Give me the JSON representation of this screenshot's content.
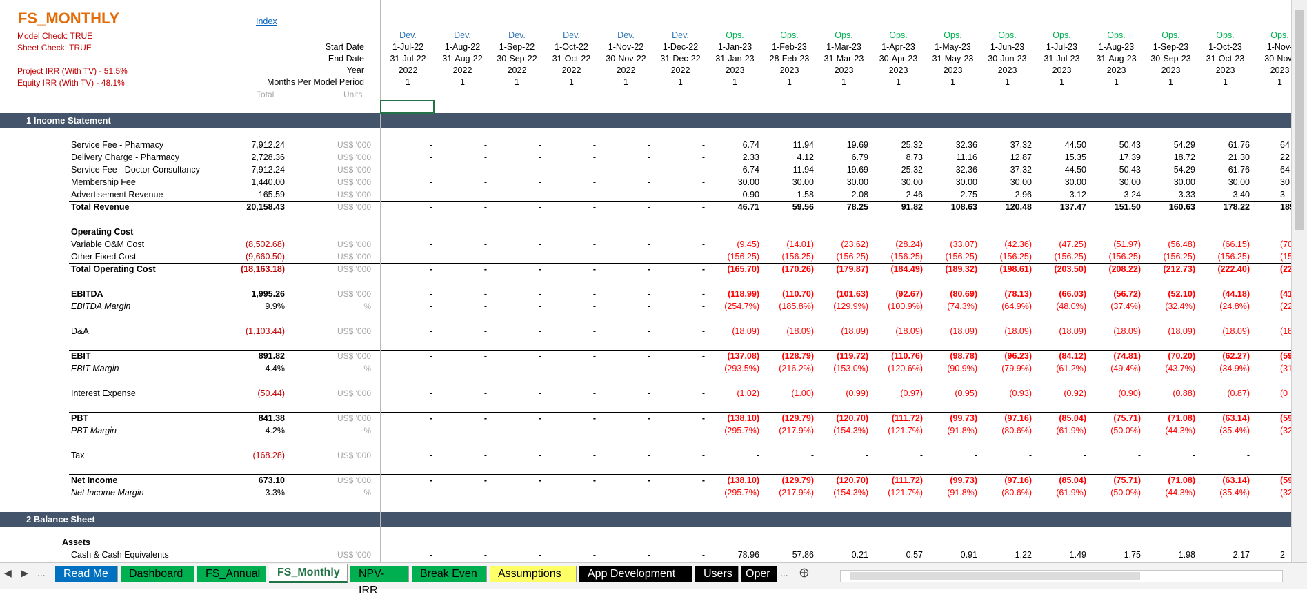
{
  "title": "FS_MONTHLY",
  "checks": {
    "model_check": "Model Check: TRUE",
    "sheet_check": "Sheet Check: TRUE",
    "project_irr": "Project IRR  (With TV) - 51.5%",
    "equity_irr": "Equity IRR  (With TV) - 48.1%"
  },
  "index_link": "Index",
  "header_labels": {
    "start_date": "Start Date",
    "end_date": "End Date",
    "year": "Year",
    "months": "Months Per Model Period",
    "total": "Total",
    "units": "Units"
  },
  "periods": [
    {
      "phase": "Dev.",
      "start": "1-Jul-22",
      "end": "31-Jul-22",
      "year": "2022",
      "months": "1"
    },
    {
      "phase": "Dev.",
      "start": "1-Aug-22",
      "end": "31-Aug-22",
      "year": "2022",
      "months": "1"
    },
    {
      "phase": "Dev.",
      "start": "1-Sep-22",
      "end": "30-Sep-22",
      "year": "2022",
      "months": "1"
    },
    {
      "phase": "Dev.",
      "start": "1-Oct-22",
      "end": "31-Oct-22",
      "year": "2022",
      "months": "1"
    },
    {
      "phase": "Dev.",
      "start": "1-Nov-22",
      "end": "30-Nov-22",
      "year": "2022",
      "months": "1"
    },
    {
      "phase": "Dev.",
      "start": "1-Dec-22",
      "end": "31-Dec-22",
      "year": "2022",
      "months": "1"
    },
    {
      "phase": "Ops.",
      "start": "1-Jan-23",
      "end": "31-Jan-23",
      "year": "2023",
      "months": "1"
    },
    {
      "phase": "Ops.",
      "start": "1-Feb-23",
      "end": "28-Feb-23",
      "year": "2023",
      "months": "1"
    },
    {
      "phase": "Ops.",
      "start": "1-Mar-23",
      "end": "31-Mar-23",
      "year": "2023",
      "months": "1"
    },
    {
      "phase": "Ops.",
      "start": "1-Apr-23",
      "end": "30-Apr-23",
      "year": "2023",
      "months": "1"
    },
    {
      "phase": "Ops.",
      "start": "1-May-23",
      "end": "31-May-23",
      "year": "2023",
      "months": "1"
    },
    {
      "phase": "Ops.",
      "start": "1-Jun-23",
      "end": "30-Jun-23",
      "year": "2023",
      "months": "1"
    },
    {
      "phase": "Ops.",
      "start": "1-Jul-23",
      "end": "31-Jul-23",
      "year": "2023",
      "months": "1"
    },
    {
      "phase": "Ops.",
      "start": "1-Aug-23",
      "end": "31-Aug-23",
      "year": "2023",
      "months": "1"
    },
    {
      "phase": "Ops.",
      "start": "1-Sep-23",
      "end": "30-Sep-23",
      "year": "2023",
      "months": "1"
    },
    {
      "phase": "Ops.",
      "start": "1-Oct-23",
      "end": "31-Oct-23",
      "year": "2023",
      "months": "1"
    },
    {
      "phase": "Ops.",
      "start": "1-Nov-",
      "end": "30-Nov-",
      "year": "2023",
      "months": "1"
    }
  ],
  "sections": {
    "income": "1  Income Statement",
    "balance": "2  Balance Sheet"
  },
  "rows": [
    {
      "label": "Service Fee - Pharmacy",
      "total": "7,912.24",
      "unit": "US$ '000",
      "style": "",
      "values": [
        "-",
        "-",
        "-",
        "-",
        "-",
        "-",
        "6.74",
        "11.94",
        "19.69",
        "25.32",
        "32.36",
        "37.32",
        "44.50",
        "50.43",
        "54.29",
        "61.76",
        "64"
      ]
    },
    {
      "label": "Delivery Charge - Pharmacy",
      "total": "2,728.36",
      "unit": "US$ '000",
      "style": "",
      "values": [
        "-",
        "-",
        "-",
        "-",
        "-",
        "-",
        "2.33",
        "4.12",
        "6.79",
        "8.73",
        "11.16",
        "12.87",
        "15.35",
        "17.39",
        "18.72",
        "21.30",
        "22"
      ]
    },
    {
      "label": "Service Fee - Doctor Consultancy",
      "total": "7,912.24",
      "unit": "US$ '000",
      "style": "",
      "values": [
        "-",
        "-",
        "-",
        "-",
        "-",
        "-",
        "6.74",
        "11.94",
        "19.69",
        "25.32",
        "32.36",
        "37.32",
        "44.50",
        "50.43",
        "54.29",
        "61.76",
        "64"
      ]
    },
    {
      "label": "Membership Fee",
      "total": "1,440.00",
      "unit": "US$ '000",
      "style": "",
      "values": [
        "-",
        "-",
        "-",
        "-",
        "-",
        "-",
        "30.00",
        "30.00",
        "30.00",
        "30.00",
        "30.00",
        "30.00",
        "30.00",
        "30.00",
        "30.00",
        "30.00",
        "30"
      ]
    },
    {
      "label": "Advertisement Revenue",
      "total": "165.59",
      "unit": "US$ '000",
      "style": "",
      "values": [
        "-",
        "-",
        "-",
        "-",
        "-",
        "-",
        "0.90",
        "1.58",
        "2.08",
        "2.46",
        "2.75",
        "2.96",
        "3.12",
        "3.24",
        "3.33",
        "3.40",
        "3"
      ]
    },
    {
      "label": "Total Revenue",
      "total": "20,158.43",
      "unit": "US$ '000",
      "style": "bold",
      "values": [
        "-",
        "-",
        "-",
        "-",
        "-",
        "-",
        "46.71",
        "59.56",
        "78.25",
        "91.82",
        "108.63",
        "120.48",
        "137.47",
        "151.50",
        "160.63",
        "178.22",
        "185"
      ]
    },
    {
      "label": "Operating Cost",
      "total": "",
      "unit": "",
      "style": "bold",
      "values": []
    },
    {
      "label": "Variable O&M Cost",
      "total": "(8,502.68)",
      "unit": "US$ '000",
      "style": "neg",
      "values": [
        "-",
        "-",
        "-",
        "-",
        "-",
        "-",
        "(9.45)",
        "(14.01)",
        "(23.62)",
        "(28.24)",
        "(33.07)",
        "(42.36)",
        "(47.25)",
        "(51.97)",
        "(56.48)",
        "(66.15)",
        "(70"
      ]
    },
    {
      "label": "Other Fixed Cost",
      "total": "(9,660.50)",
      "unit": "US$ '000",
      "style": "neg",
      "values": [
        "-",
        "-",
        "-",
        "-",
        "-",
        "-",
        "(156.25)",
        "(156.25)",
        "(156.25)",
        "(156.25)",
        "(156.25)",
        "(156.25)",
        "(156.25)",
        "(156.25)",
        "(156.25)",
        "(156.25)",
        "(156"
      ]
    },
    {
      "label": "Total Operating Cost",
      "total": "(18,163.18)",
      "unit": "US$ '000",
      "style": "bold neg",
      "values": [
        "-",
        "-",
        "-",
        "-",
        "-",
        "-",
        "(165.70)",
        "(170.26)",
        "(179.87)",
        "(184.49)",
        "(189.32)",
        "(198.61)",
        "(203.50)",
        "(208.22)",
        "(212.73)",
        "(222.40)",
        "(226"
      ]
    },
    {
      "label": "EBITDA",
      "total": "1,995.26",
      "unit": "US$ '000",
      "style": "bold",
      "values": [
        "-",
        "-",
        "-",
        "-",
        "-",
        "-",
        "(118.99)",
        "(110.70)",
        "(101.63)",
        "(92.67)",
        "(80.69)",
        "(78.13)",
        "(66.03)",
        "(56.72)",
        "(52.10)",
        "(44.18)",
        "(41"
      ]
    },
    {
      "label": "EBITDA Margin",
      "total": "9.9%",
      "unit": "%",
      "style": "ital",
      "values": [
        "-",
        "-",
        "-",
        "-",
        "-",
        "-",
        "(254.7%)",
        "(185.8%)",
        "(129.9%)",
        "(100.9%)",
        "(74.3%)",
        "(64.9%)",
        "(48.0%)",
        "(37.4%)",
        "(32.4%)",
        "(24.8%)",
        "(22."
      ]
    },
    {
      "label": "D&A",
      "total": "(1,103.44)",
      "unit": "US$ '000",
      "style": "neg",
      "values": [
        "-",
        "-",
        "-",
        "-",
        "-",
        "-",
        "(18.09)",
        "(18.09)",
        "(18.09)",
        "(18.09)",
        "(18.09)",
        "(18.09)",
        "(18.09)",
        "(18.09)",
        "(18.09)",
        "(18.09)",
        "(18"
      ]
    },
    {
      "label": "EBIT",
      "total": "891.82",
      "unit": "US$ '000",
      "style": "bold",
      "values": [
        "-",
        "-",
        "-",
        "-",
        "-",
        "-",
        "(137.08)",
        "(128.79)",
        "(119.72)",
        "(110.76)",
        "(98.78)",
        "(96.23)",
        "(84.12)",
        "(74.81)",
        "(70.20)",
        "(62.27)",
        "(59"
      ]
    },
    {
      "label": "EBIT Margin",
      "total": "4.4%",
      "unit": "%",
      "style": "ital",
      "values": [
        "-",
        "-",
        "-",
        "-",
        "-",
        "-",
        "(293.5%)",
        "(216.2%)",
        "(153.0%)",
        "(120.6%)",
        "(90.9%)",
        "(79.9%)",
        "(61.2%)",
        "(49.4%)",
        "(43.7%)",
        "(34.9%)",
        "(31."
      ]
    },
    {
      "label": "Interest Expense",
      "total": "(50.44)",
      "unit": "US$ '000",
      "style": "neg",
      "values": [
        "-",
        "-",
        "-",
        "-",
        "-",
        "-",
        "(1.02)",
        "(1.00)",
        "(0.99)",
        "(0.97)",
        "(0.95)",
        "(0.93)",
        "(0.92)",
        "(0.90)",
        "(0.88)",
        "(0.87)",
        "(0"
      ]
    },
    {
      "label": "PBT",
      "total": "841.38",
      "unit": "US$ '000",
      "style": "bold",
      "values": [
        "-",
        "-",
        "-",
        "-",
        "-",
        "-",
        "(138.10)",
        "(129.79)",
        "(120.70)",
        "(111.72)",
        "(99.73)",
        "(97.16)",
        "(85.04)",
        "(75.71)",
        "(71.08)",
        "(63.14)",
        "(59"
      ]
    },
    {
      "label": "PBT Margin",
      "total": "4.2%",
      "unit": "%",
      "style": "ital",
      "values": [
        "-",
        "-",
        "-",
        "-",
        "-",
        "-",
        "(295.7%)",
        "(217.9%)",
        "(154.3%)",
        "(121.7%)",
        "(91.8%)",
        "(80.6%)",
        "(61.9%)",
        "(50.0%)",
        "(44.3%)",
        "(35.4%)",
        "(32."
      ]
    },
    {
      "label": "Tax",
      "total": "(168.28)",
      "unit": "US$ '000",
      "style": "neg",
      "values": [
        "-",
        "-",
        "-",
        "-",
        "-",
        "-",
        "-",
        "-",
        "-",
        "-",
        "-",
        "-",
        "-",
        "-",
        "-",
        "-",
        ""
      ]
    },
    {
      "label": "Net Income",
      "total": "673.10",
      "unit": "US$ '000",
      "style": "bold",
      "values": [
        "-",
        "-",
        "-",
        "-",
        "-",
        "-",
        "(138.10)",
        "(129.79)",
        "(120.70)",
        "(111.72)",
        "(99.73)",
        "(97.16)",
        "(85.04)",
        "(75.71)",
        "(71.08)",
        "(63.14)",
        "(59"
      ]
    },
    {
      "label": "Net Income Margin",
      "total": "3.3%",
      "unit": "%",
      "style": "ital",
      "values": [
        "-",
        "-",
        "-",
        "-",
        "-",
        "-",
        "(295.7%)",
        "(217.9%)",
        "(154.3%)",
        "(121.7%)",
        "(91.8%)",
        "(80.6%)",
        "(61.9%)",
        "(50.0%)",
        "(44.3%)",
        "(35.4%)",
        "(32."
      ]
    },
    {
      "label": "Assets",
      "total": "",
      "unit": "",
      "style": "bold",
      "values": []
    },
    {
      "label": "Cash & Cash Equivalents",
      "total": "",
      "unit": "US$ '000",
      "style": "",
      "values": [
        "-",
        "-",
        "-",
        "-",
        "-",
        "-",
        "78.96",
        "57.86",
        "0.21",
        "0.57",
        "0.91",
        "1.22",
        "1.49",
        "1.75",
        "1.98",
        "2.17",
        "2"
      ]
    }
  ],
  "tabs": [
    {
      "label": "Read Me",
      "bg": "#0070c0",
      "fg": "#ffffff"
    },
    {
      "label": "Dashboard",
      "bg": "#00b050",
      "fg": "#000000"
    },
    {
      "label": "FS_Annual",
      "bg": "#00b050",
      "fg": "#000000"
    },
    {
      "label": "FS_Monthly",
      "bg": "#ffffff",
      "fg": "#217346"
    },
    {
      "label": "NPV-IRR",
      "bg": "#00b050",
      "fg": "#000000"
    },
    {
      "label": "Break Even",
      "bg": "#00b050",
      "fg": "#000000"
    },
    {
      "label": "Assumptions",
      "bg": "#ffff66",
      "fg": "#000000"
    },
    {
      "label": "App Development",
      "bg": "#000000",
      "fg": "#ffffff"
    },
    {
      "label": "Users",
      "bg": "#000000",
      "fg": "#ffffff"
    },
    {
      "label": "Oper",
      "bg": "#000000",
      "fg": "#ffffff"
    }
  ],
  "tab_nav": {
    "prev": "◀",
    "next": "▶",
    "more": "...",
    "more2": "...",
    "add": "⊕"
  }
}
